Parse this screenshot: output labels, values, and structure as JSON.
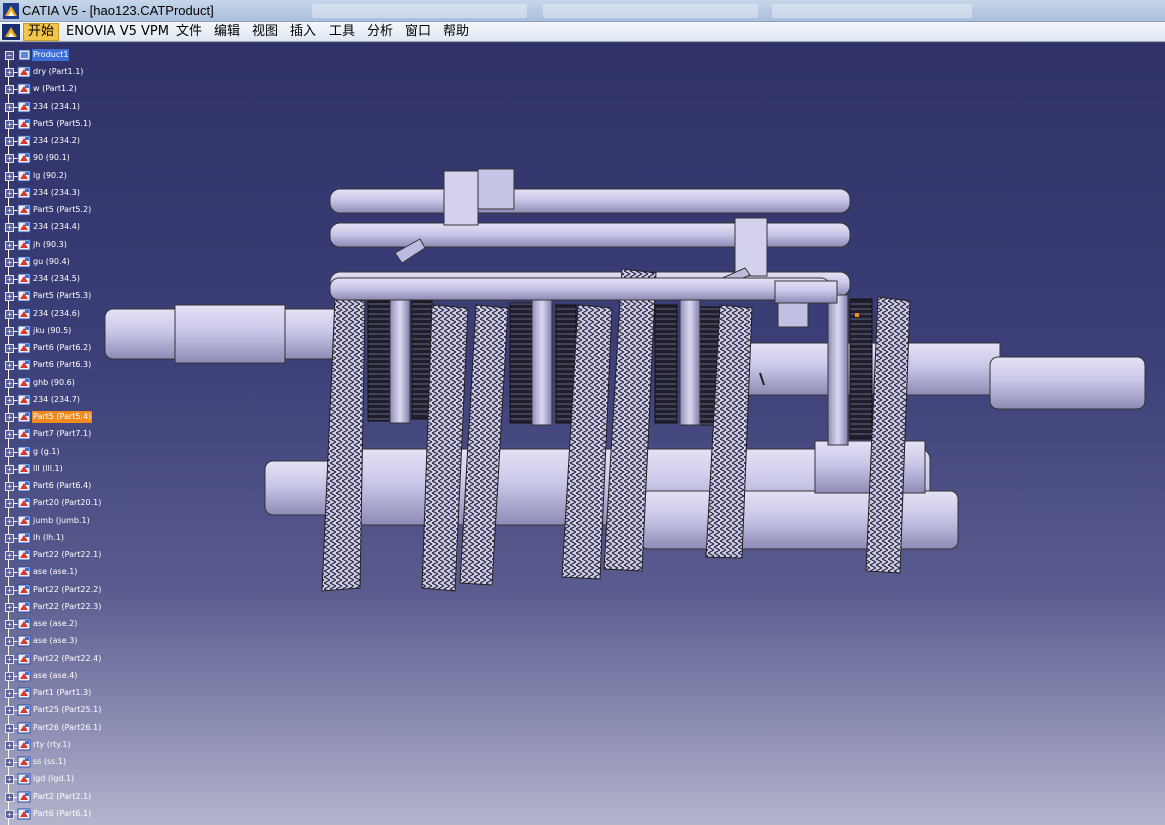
{
  "window": {
    "title": "CATIA V5 - [hao123.CATProduct]"
  },
  "menu": {
    "items": [
      "开始",
      "ENOVIA V5 VPM",
      "文件",
      "编辑",
      "视图",
      "插入",
      "工具",
      "分析",
      "窗口",
      "帮助"
    ],
    "active_index": 0
  },
  "tree": {
    "root": "Product1",
    "selected_index": 20,
    "nodes": [
      "dry (Part1.1)",
      "w (Part1.2)",
      "234 (234.1)",
      "Part5 (Part5.1)",
      "234 (234.2)",
      "90 (90.1)",
      "lg (90.2)",
      "234 (234.3)",
      "Part5 (Part5.2)",
      "234 (234.4)",
      "jh (90.3)",
      "gu (90.4)",
      "234 (234.5)",
      "Part5 (Part5.3)",
      "234 (234.6)",
      "jku (90.5)",
      "Part6 (Part6.2)",
      "Part6 (Part6.3)",
      "ghb (90.6)",
      "234 (234.7)",
      "Part5 (Part5.4)",
      "Part7 (Part7.1)",
      "g (g.1)",
      "lll (lll.1)",
      "Part6 (Part6.4)",
      "Part20 (Part20.1)",
      "jumb (jumb.1)",
      "lh (lh.1)",
      "Part22 (Part22.1)",
      "ase (ase.1)",
      "Part22 (Part22.2)",
      "Part22 (Part22.3)",
      "ase (ase.2)",
      "ase (ase.3)",
      "Part22 (Part22.4)",
      "ase (ase.4)",
      "Part1 (Part1.3)",
      "Part25 (Part25.1)",
      "Part26 (Part26.1)",
      "rty (rty.1)",
      "ss (ss.1)",
      "lgd (lgd.1)",
      "Part2 (Part2.1)",
      "Part6 (Part6.1)"
    ]
  },
  "colors": {
    "accent_selected": "#f08a1c",
    "menu_active": "#f3c64a",
    "viewport_top": "#2f3168",
    "viewport_bottom": "#b4b5cd",
    "part_metal": "#c9c7e8"
  },
  "icons": {
    "app": "catia-logo-icon",
    "part": "part-icon",
    "expander": "expand-plus-icon"
  }
}
